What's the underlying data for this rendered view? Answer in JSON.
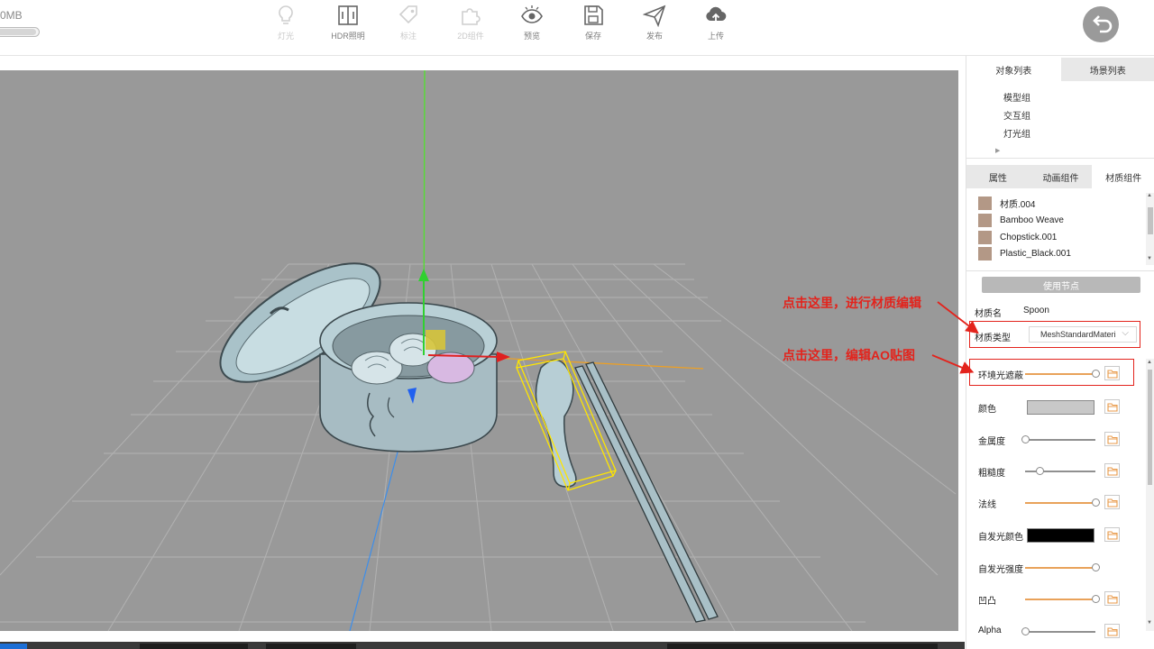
{
  "toolbar": {
    "memory_label": "0MB",
    "memory_usage_fraction": 0.95,
    "tools": [
      {
        "label": "灯光",
        "icon": "lightbulb-icon",
        "enabled": false
      },
      {
        "label": "HDR照明",
        "icon": "hdr-lighting-icon",
        "enabled": true
      },
      {
        "label": "标注",
        "icon": "tag-icon",
        "enabled": false
      },
      {
        "label": "2D组件",
        "icon": "puzzle-icon",
        "enabled": false
      },
      {
        "label": "预览",
        "icon": "eye-icon",
        "enabled": true
      },
      {
        "label": "保存",
        "icon": "save-icon",
        "enabled": true
      },
      {
        "label": "发布",
        "icon": "send-icon",
        "enabled": true
      },
      {
        "label": "上传",
        "icon": "cloud-upload-icon",
        "enabled": true
      }
    ],
    "back_icon": "back-arrow-icon"
  },
  "panel": {
    "top_tabs": [
      {
        "label": "对象列表",
        "active": true
      },
      {
        "label": "场景列表",
        "active": false
      }
    ],
    "tree": [
      "模型组",
      "交互组",
      "灯光组"
    ],
    "prop_tabs": [
      {
        "label": "属性",
        "active": false
      },
      {
        "label": "动画组件",
        "active": false
      },
      {
        "label": "材质组件",
        "active": true
      }
    ],
    "materials": [
      {
        "name": "材质.004",
        "swatch": "#b39886"
      },
      {
        "name": "Bamboo Weave",
        "swatch": "#b39886"
      },
      {
        "name": "Chopstick.001",
        "swatch": "#b39886"
      },
      {
        "name": "Plastic_Black.001",
        "swatch": "#b39886"
      }
    ],
    "node_button": "使用节点",
    "material_name_label": "材质名",
    "material_name_value": "Spoon",
    "material_type_label": "材质类型",
    "material_type_value": "MeshStandardMateri",
    "properties": [
      {
        "label": "环境光遮蔽",
        "kind": "slider",
        "value": 1.0,
        "track": "orange",
        "folder": true
      },
      {
        "label": "颜色",
        "kind": "color",
        "color": "#c8c8c8",
        "folder": true
      },
      {
        "label": "金属度",
        "kind": "slider",
        "value": 0.0,
        "track": "gray",
        "folder": true
      },
      {
        "label": "粗糙度",
        "kind": "slider",
        "value": 0.2,
        "track": "gray",
        "folder": true
      },
      {
        "label": "法线",
        "kind": "slider",
        "value": 1.0,
        "track": "orange",
        "folder": true
      },
      {
        "label": "自发光颜色",
        "kind": "color",
        "color": "#000000",
        "folder": true
      },
      {
        "label": "自发光强度",
        "kind": "slider",
        "value": 1.0,
        "track": "orange",
        "folder": false
      },
      {
        "label": "凹凸",
        "kind": "slider",
        "value": 1.0,
        "track": "orange",
        "folder": true
      },
      {
        "label": "Alpha",
        "kind": "slider",
        "value": 0.0,
        "track": "gray",
        "folder": true
      }
    ]
  },
  "annotations": {
    "callout_1": "点击这里，进行材质编辑",
    "callout_2": "点击这里，编辑AO贴图",
    "color": "#e3231c"
  },
  "viewport": {
    "background": "#999999",
    "selected_object_box_color": "#ffe600"
  }
}
